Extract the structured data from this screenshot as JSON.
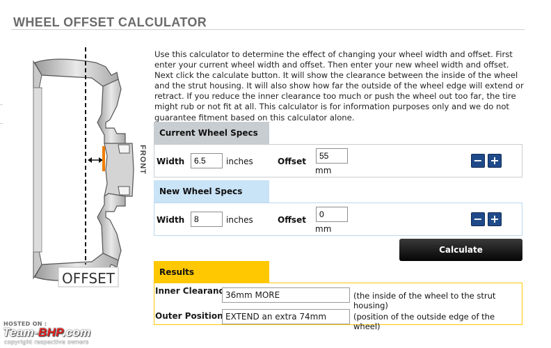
{
  "page": {
    "title": "WHEEL OFFSET CALCULATOR",
    "description": "Use this calculator to determine the effect of changing your wheel width and offset. First enter your current wheel width and offset. Then enter your new wheel width and offset. Next click the calculate button. It will show the clearance between the inside of the wheel and the strut housing. It will also show how far the outside of the wheel edge will extend or retract. If you reduce the inner clearance too much or push the wheel out too far, the tire might rub or not fit at all. This calculator is for information purposes only and we do not guarantee fitment based on this calculator alone."
  },
  "diagram": {
    "front_label": "FRONT",
    "offset_label": "OFFSET",
    "accent_color": "#f07c00"
  },
  "current": {
    "heading": "Current Wheel Specs",
    "width_label": "Width",
    "width_value": "6.5",
    "width_unit": "inches",
    "offset_label": "Offset",
    "offset_value": "55",
    "offset_unit": "mm",
    "minus_label": "−",
    "plus_label": "+"
  },
  "new": {
    "heading": "New Wheel Specs",
    "width_label": "Width",
    "width_value": "8",
    "width_unit": "inches",
    "offset_label": "Offset",
    "offset_value": "0",
    "offset_unit": "mm",
    "minus_label": "−",
    "plus_label": "+"
  },
  "calculate_label": "Calculate",
  "results": {
    "heading": "Results",
    "inner_label": "Inner Clearance:",
    "inner_value": "36mm MORE",
    "inner_note": "(the inside of the wheel to the strut housing)",
    "outer_label": "Outer Position:",
    "outer_value": "EXTEND an extra 74mm",
    "outer_note": "(position of the outside edge of the wheel)"
  },
  "watermark": {
    "hosted": "HOSTED ON :",
    "brand_a": "Team-",
    "brand_b": "BHP",
    "brand_c": ".com",
    "copyright": "copyright respective owners"
  },
  "colors": {
    "current_tab": "#c8cdd1",
    "new_tab": "#c9e3f7",
    "results_tab": "#ffc800",
    "stepper": "#1f4a8a"
  }
}
